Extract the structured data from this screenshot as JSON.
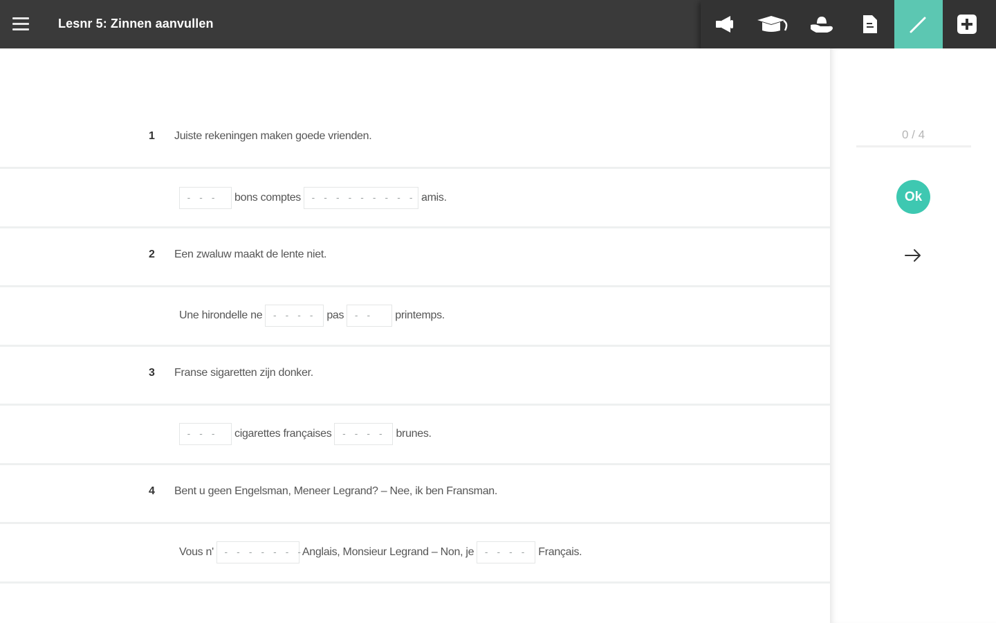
{
  "header": {
    "title": "Lesnr 5: Zinnen aanvullen",
    "toolbar": [
      {
        "name": "audio",
        "icon": "speaker-icon"
      },
      {
        "name": "lesson",
        "icon": "graduation-cap-icon"
      },
      {
        "name": "exercise",
        "icon": "hand-icon"
      },
      {
        "name": "document",
        "icon": "document-icon"
      },
      {
        "name": "write",
        "icon": "pen-icon",
        "active": true
      },
      {
        "name": "add",
        "icon": "plus-square-icon"
      }
    ]
  },
  "questions": [
    {
      "number": "1",
      "text": "Juiste rekeningen maken goede vrienden.",
      "answer": {
        "parts": [
          {
            "type": "blank",
            "value": "- - -"
          },
          {
            "type": "text",
            "value": "bons comptes"
          },
          {
            "type": "blank",
            "value": "- - - -   - - -   - - - -"
          },
          {
            "type": "text",
            "value": "amis."
          }
        ]
      }
    },
    {
      "number": "2",
      "text": "Een zwaluw maakt de lente niet.",
      "answer": {
        "parts": [
          {
            "type": "text",
            "value": "Une hirondelle ne"
          },
          {
            "type": "blank",
            "value": "- - - -"
          },
          {
            "type": "text",
            "value": "pas"
          },
          {
            "type": "blank",
            "value": "- -"
          },
          {
            "type": "text",
            "value": "printemps."
          }
        ]
      }
    },
    {
      "number": "3",
      "text": "Franse sigaretten zijn donker.",
      "answer": {
        "parts": [
          {
            "type": "blank",
            "value": "- - -"
          },
          {
            "type": "text",
            "value": "cigarettes françaises"
          },
          {
            "type": "blank",
            "value": "- - - -"
          },
          {
            "type": "text",
            "value": "brunes."
          }
        ]
      }
    },
    {
      "number": "4",
      "text": "Bent u geen Engelsman, Meneer Legrand? – Nee, ik ben Fransman.",
      "answer": {
        "parts": [
          {
            "type": "text",
            "value": "Vous n'"
          },
          {
            "type": "blank",
            "value": "- - - -   - - -"
          },
          {
            "type": "text",
            "value": "Anglais, Monsieur Legrand – Non, je"
          },
          {
            "type": "blank",
            "value": "- - - -"
          },
          {
            "type": "text",
            "value": "Français."
          }
        ]
      }
    }
  ],
  "sidebar": {
    "score": "0 / 4",
    "ok_label": "Ok",
    "next_icon": "arrow-right-icon"
  },
  "colors": {
    "topbar": "#3a3a3a",
    "accent": "#3ec8b1",
    "active_tool": "#5cc7b2"
  }
}
